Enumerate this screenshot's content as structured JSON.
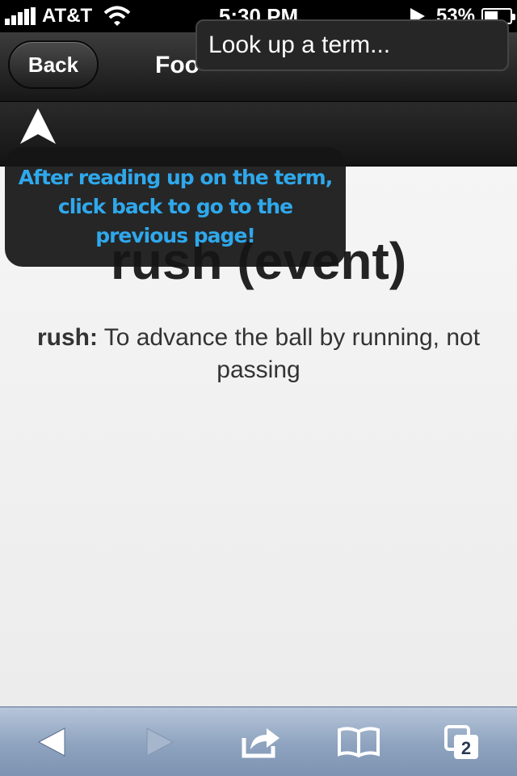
{
  "status_bar": {
    "carrier": "AT&T",
    "time": "5:30 PM",
    "battery_percent": "53%",
    "battery_level": 0.53,
    "icons": [
      "signal-bars-icon",
      "wifi-icon",
      "play-icon",
      "battery-icon"
    ]
  },
  "nav": {
    "back_label": "Back",
    "title_partial": "Foo",
    "search_placeholder": "Look up a term..."
  },
  "tooltip": {
    "text": "After reading up on the term, click back to go to the previous page!"
  },
  "content": {
    "term_title": "rush (event)",
    "term": "rush:",
    "definition": " To advance the ball by running, not passing"
  },
  "toolbar": {
    "tab_count": "2",
    "icons": [
      "back-arrow-icon",
      "forward-arrow-icon",
      "share-icon",
      "bookmarks-icon",
      "tabs-icon"
    ]
  },
  "colors": {
    "tooltip_text": "#2fa8ec",
    "bottom_bar": "#8ea3bf"
  }
}
